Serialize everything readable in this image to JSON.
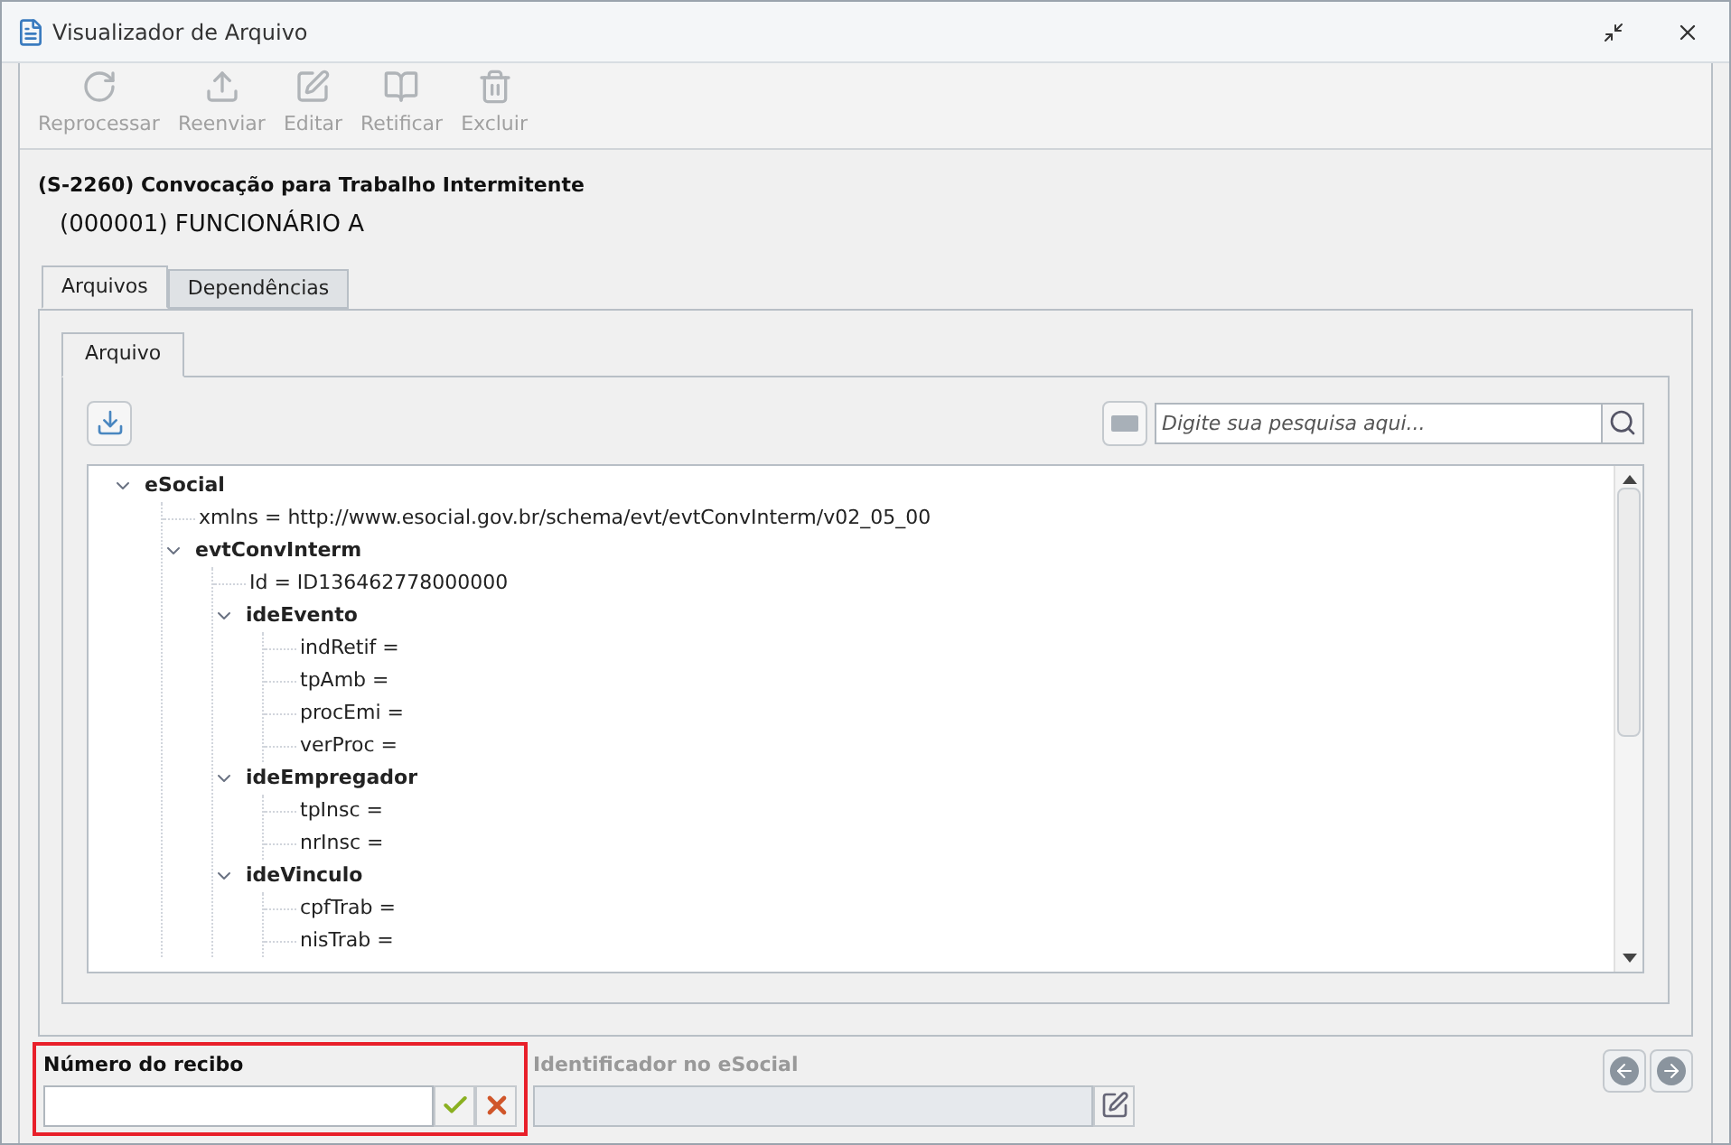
{
  "window": {
    "title": "Visualizador de Arquivo"
  },
  "toolbar": [
    {
      "label": "Reprocessar",
      "disabled": true
    },
    {
      "label": "Reenviar",
      "disabled": true
    },
    {
      "label": "Editar",
      "disabled": true
    },
    {
      "label": "Retificar",
      "disabled": true
    },
    {
      "label": "Excluir",
      "disabled": true
    }
  ],
  "event_title": "(S-2260) Convocação para Trabalho Intermitente",
  "employee": "(000001) FUNCIONÁRIO A",
  "tabs": [
    {
      "label": "Arquivos",
      "selected": true
    },
    {
      "label": "Dependências",
      "selected": false
    }
  ],
  "inner_tabs": [
    {
      "label": "Arquivo",
      "selected": true
    }
  ],
  "search": {
    "placeholder": "Digite sua pesquisa aqui..."
  },
  "tree": [
    {
      "kind": "element",
      "label": "eSocial",
      "expanded": true,
      "children": [
        {
          "kind": "attribute",
          "label": "xmlns = http://www.esocial.gov.br/schema/evt/evtConvInterm/v02_05_00"
        },
        {
          "kind": "element",
          "label": "evtConvInterm",
          "expanded": true,
          "children": [
            {
              "kind": "attribute",
              "label": "Id = ID136462778000000"
            },
            {
              "kind": "element",
              "label": "ideEvento",
              "expanded": true,
              "children": [
                {
                  "kind": "attribute",
                  "label": "indRetif ="
                },
                {
                  "kind": "attribute",
                  "label": "tpAmb ="
                },
                {
                  "kind": "attribute",
                  "label": "procEmi ="
                },
                {
                  "kind": "attribute",
                  "label": "verProc ="
                }
              ]
            },
            {
              "kind": "element",
              "label": "ideEmpregador",
              "expanded": true,
              "children": [
                {
                  "kind": "attribute",
                  "label": "tpInsc ="
                },
                {
                  "kind": "attribute",
                  "label": "nrInsc ="
                }
              ]
            },
            {
              "kind": "element",
              "label": "ideVinculo",
              "expanded": true,
              "children": [
                {
                  "kind": "attribute",
                  "label": "cpfTrab ="
                },
                {
                  "kind": "attribute",
                  "label": "nisTrab ="
                }
              ]
            }
          ]
        }
      ]
    }
  ],
  "receipt": {
    "label": "Número do recibo",
    "highlighted": true
  },
  "esocial_id": {
    "label": "Identificador no eSocial",
    "disabled": true
  }
}
